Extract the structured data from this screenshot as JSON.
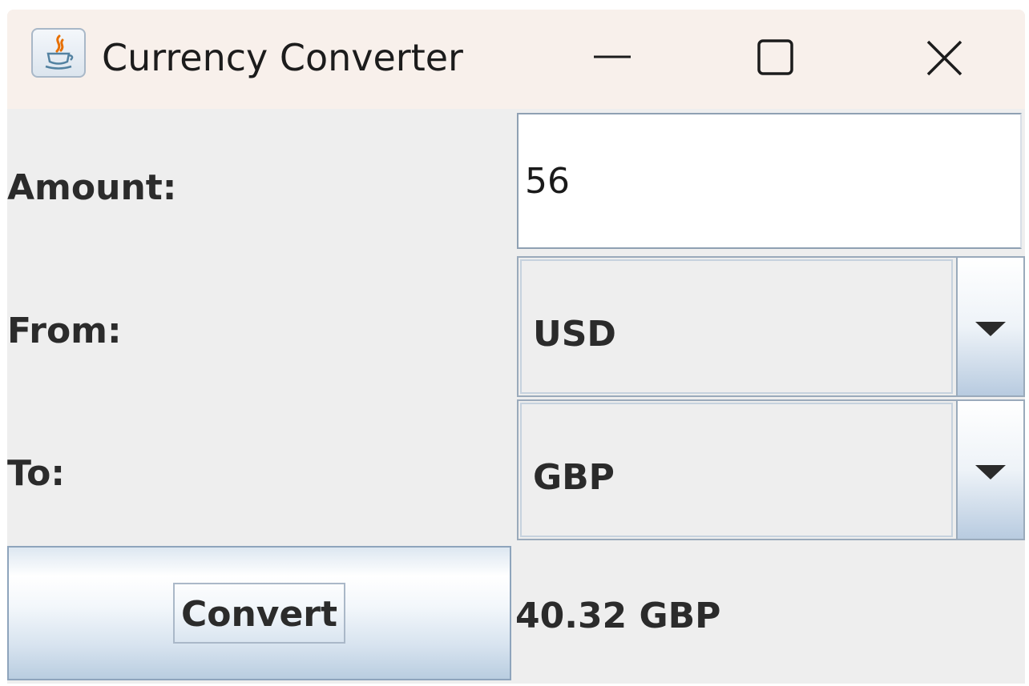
{
  "window": {
    "title": "Currency Converter",
    "icon": "java-cup-icon",
    "controls": [
      "minimize-icon",
      "maximize-icon",
      "close-icon"
    ]
  },
  "form": {
    "amount_label": "Amount:",
    "amount_value": "56",
    "from_label": "From:",
    "from_value": "USD",
    "to_label": "To:",
    "to_value": "GBP",
    "convert_label": "Convert",
    "result": "40.32 GBP"
  },
  "colors": {
    "titlebar": "#f8f0eb",
    "panel": "#eeeeee",
    "text": "#2b2b2b",
    "java_flame": "#e76f00",
    "java_cup": "#5382a1"
  }
}
